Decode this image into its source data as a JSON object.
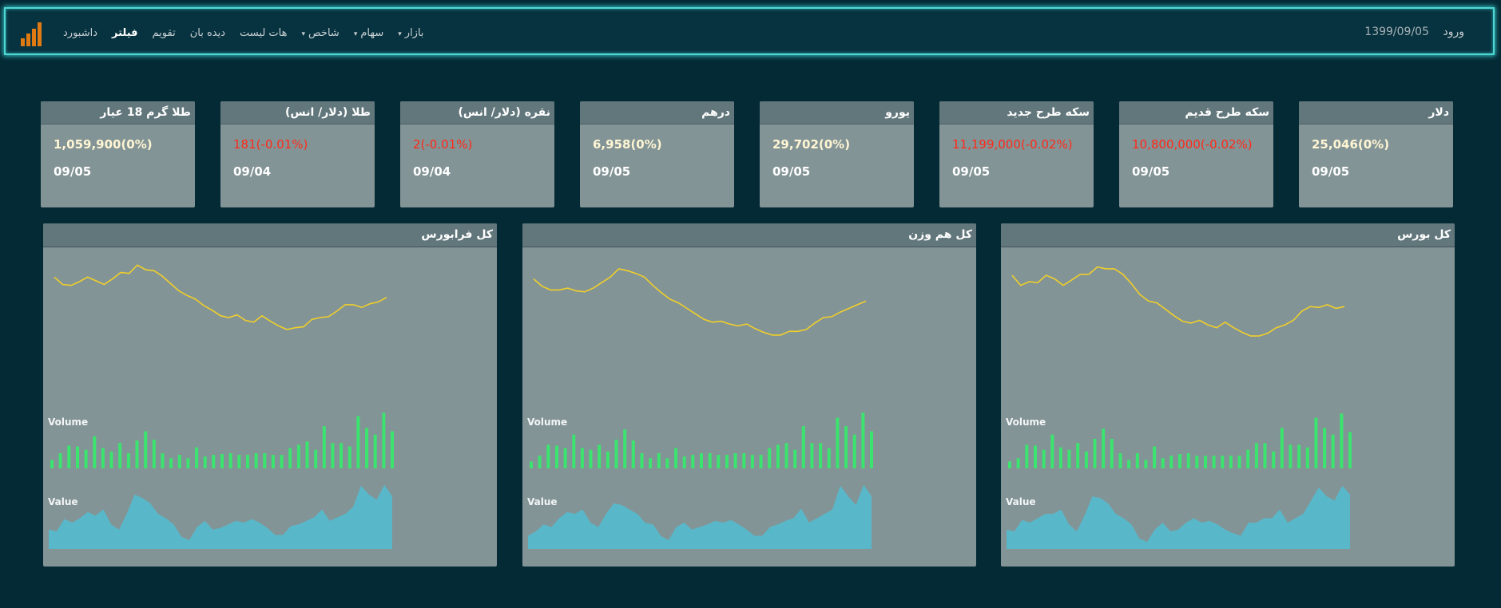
{
  "nav": {
    "login": "ورود",
    "date": "1399/09/05",
    "links": [
      {
        "label": "داشبورد",
        "active": false,
        "dropdown": false
      },
      {
        "label": "فیلتر",
        "active": true,
        "dropdown": false
      },
      {
        "label": "تقویم",
        "active": false,
        "dropdown": false
      },
      {
        "label": "دیده بان",
        "active": false,
        "dropdown": false
      },
      {
        "label": "هات لیست",
        "active": false,
        "dropdown": false
      },
      {
        "label": "شاخص",
        "active": false,
        "dropdown": true
      },
      {
        "label": "سهام",
        "active": false,
        "dropdown": true
      },
      {
        "label": "بازار",
        "active": false,
        "dropdown": true
      }
    ],
    "logo_icon": "bar-chart-logo-icon"
  },
  "colors": {
    "background": "#042a35",
    "card": "#839496",
    "card_header": "#62777c",
    "positive": "#fff6d4",
    "negative": "#ff2a1a",
    "line": "#f0cf2a",
    "volume_bar": "#3be46e",
    "value_area": "#58b8c9",
    "nav_glow": "#4fd7d5"
  },
  "cards": [
    {
      "title": "دلار",
      "value": "25,046(0%)",
      "negative": false,
      "date": "09/05"
    },
    {
      "title": "سکه طرح قدیم",
      "value": "10,800,000(-0.02%)",
      "negative": true,
      "date": "09/05"
    },
    {
      "title": "سکه طرح جدید",
      "value": "11,199,000(-0.02%)",
      "negative": true,
      "date": "09/05"
    },
    {
      "title": "یورو",
      "value": "29,702(0%)",
      "negative": false,
      "date": "09/05"
    },
    {
      "title": "درهم",
      "value": "6,958(0%)",
      "negative": false,
      "date": "09/05"
    },
    {
      "title": "نقره (دلار/ انس)",
      "value": "2(-0.01%)",
      "negative": true,
      "date": "09/04"
    },
    {
      "title": "طلا (دلار/ انس)",
      "value": "181(-0.01%)",
      "negative": true,
      "date": "09/04"
    },
    {
      "title": "طلا گرم 18 عیار",
      "value": "1,059,900(0%)",
      "negative": false,
      "date": "09/05"
    }
  ],
  "panels": [
    {
      "title": "کل بورس",
      "volume_label": "Volume",
      "value_label": "Value",
      "chart_data": {
        "type": "line",
        "line": [
          62,
          51,
          55,
          54,
          62,
          58,
          51,
          57,
          63,
          63,
          71,
          69,
          69,
          63,
          53,
          41,
          34,
          32,
          25,
          18,
          12,
          10,
          13,
          8,
          5,
          11,
          5,
          0,
          -4,
          -4,
          -1,
          5,
          8,
          13,
          23,
          28,
          27,
          30,
          26,
          28
        ],
        "volume": [
          8,
          12,
          28,
          27,
          22,
          40,
          25,
          22,
          30,
          20,
          35,
          47,
          35,
          18,
          10,
          18,
          10,
          26,
          12,
          15,
          17,
          18,
          15,
          15,
          15,
          15,
          15,
          15,
          22,
          30,
          30,
          20,
          48,
          28,
          28,
          25,
          60,
          48,
          40,
          65,
          43
        ],
        "value": [
          22,
          20,
          33,
          30,
          35,
          40,
          40,
          45,
          28,
          20,
          38,
          60,
          58,
          52,
          40,
          35,
          28,
          12,
          8,
          22,
          30,
          20,
          22,
          30,
          35,
          30,
          32,
          28,
          22,
          18,
          15,
          30,
          30,
          35,
          35,
          45,
          30,
          35,
          40,
          55,
          70,
          60,
          55,
          72,
          62
        ]
      }
    },
    {
      "title": "کل هم وزن",
      "volume_label": "Volume",
      "value_label": "Value",
      "chart_data": {
        "type": "line",
        "line": [
          58,
          50,
          46,
          46,
          48,
          45,
          44,
          48,
          54,
          60,
          69,
          67,
          64,
          60,
          51,
          43,
          36,
          32,
          26,
          20,
          14,
          11,
          12,
          9,
          7,
          9,
          4,
          0,
          -3,
          -3,
          1,
          1,
          3,
          10,
          16,
          17,
          22,
          26,
          30,
          34
        ],
        "volume": [
          8,
          15,
          28,
          27,
          24,
          40,
          24,
          22,
          28,
          20,
          34,
          46,
          33,
          18,
          12,
          18,
          12,
          24,
          14,
          16,
          18,
          18,
          16,
          16,
          18,
          18,
          16,
          16,
          24,
          28,
          30,
          22,
          50,
          30,
          30,
          24,
          60,
          50,
          40,
          66,
          44
        ],
        "value": [
          15,
          20,
          28,
          25,
          35,
          42,
          40,
          45,
          30,
          25,
          40,
          52,
          50,
          45,
          40,
          30,
          28,
          15,
          10,
          25,
          30,
          22,
          25,
          28,
          32,
          30,
          33,
          28,
          22,
          15,
          15,
          25,
          28,
          32,
          35,
          46,
          30,
          35,
          40,
          45,
          72,
          60,
          50,
          73,
          60
        ]
      }
    },
    {
      "title": "کل فرابورس",
      "volume_label": "Volume",
      "value_label": "Value",
      "chart_data": {
        "type": "line",
        "line": [
          60,
          52,
          51,
          55,
          60,
          56,
          52,
          58,
          65,
          64,
          73,
          68,
          67,
          61,
          53,
          45,
          40,
          36,
          29,
          24,
          18,
          16,
          19,
          13,
          11,
          18,
          12,
          7,
          3,
          5,
          6,
          14,
          16,
          17,
          23,
          30,
          30,
          27,
          31,
          33,
          38
        ],
        "volume": [
          10,
          18,
          27,
          26,
          22,
          38,
          24,
          20,
          30,
          18,
          33,
          44,
          34,
          18,
          12,
          16,
          12,
          25,
          14,
          16,
          17,
          18,
          16,
          16,
          18,
          18,
          16,
          16,
          24,
          28,
          32,
          22,
          50,
          30,
          30,
          26,
          62,
          48,
          40,
          66,
          44
        ],
        "value": [
          22,
          20,
          34,
          30,
          35,
          42,
          38,
          45,
          28,
          22,
          40,
          62,
          58,
          52,
          40,
          35,
          28,
          14,
          10,
          25,
          32,
          22,
          24,
          28,
          32,
          30,
          34,
          30,
          24,
          16,
          16,
          26,
          28,
          32,
          36,
          45,
          32,
          36,
          40,
          48,
          72,
          62,
          56,
          73,
          60
        ]
      }
    }
  ]
}
